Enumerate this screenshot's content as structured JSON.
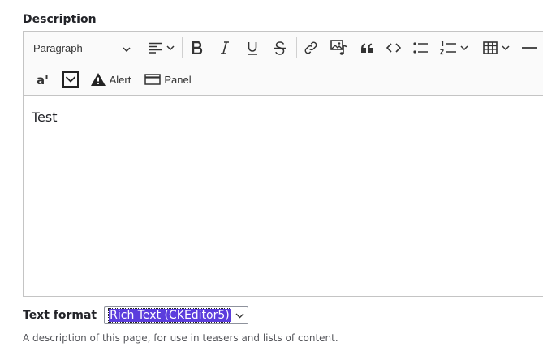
{
  "field": {
    "label": "Description",
    "content": "Test",
    "help": "A description of this page, for use in teasers and lists of content."
  },
  "toolbar": {
    "heading": "Paragraph",
    "alert_label": "Alert",
    "panel_label": "Panel"
  },
  "text_format": {
    "label": "Text format",
    "selected": "Rich Text (CKEditor5)"
  }
}
